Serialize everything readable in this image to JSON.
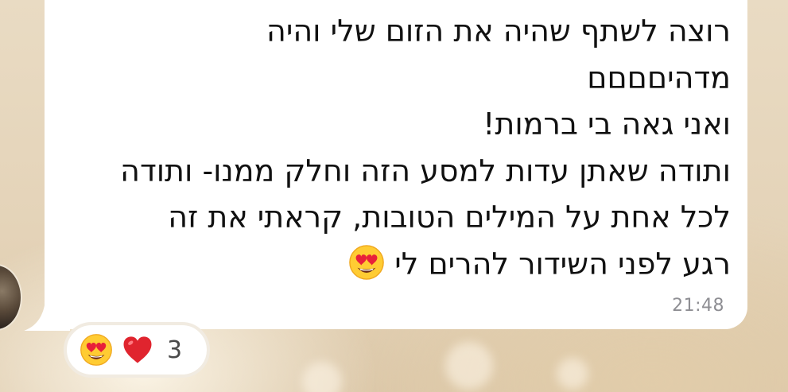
{
  "message": {
    "lines": [
      "רוצה לשתף שהיה את הזום שלי והיה",
      "מדהיםםםם",
      "ואני גאה בי ברמות!",
      "ותודה שאתן עדות למסע הזה וחלק ממנו- ותודה",
      "לכל אחת על המילים הטובות, קראתי את זה",
      "רגע לפני השידור להרים לי"
    ],
    "inline_emoji": "heart-eyes-icon",
    "timestamp": "21:48"
  },
  "reactions": {
    "items": [
      "heart-eyes-icon",
      "red-heart-icon"
    ],
    "count": "3"
  },
  "colors": {
    "bubble": "#ffffff",
    "background": "#e6d6bc",
    "timestamp": "#8e8e93",
    "heart": "#e0242e",
    "emoji_face": "#ffcc33"
  }
}
